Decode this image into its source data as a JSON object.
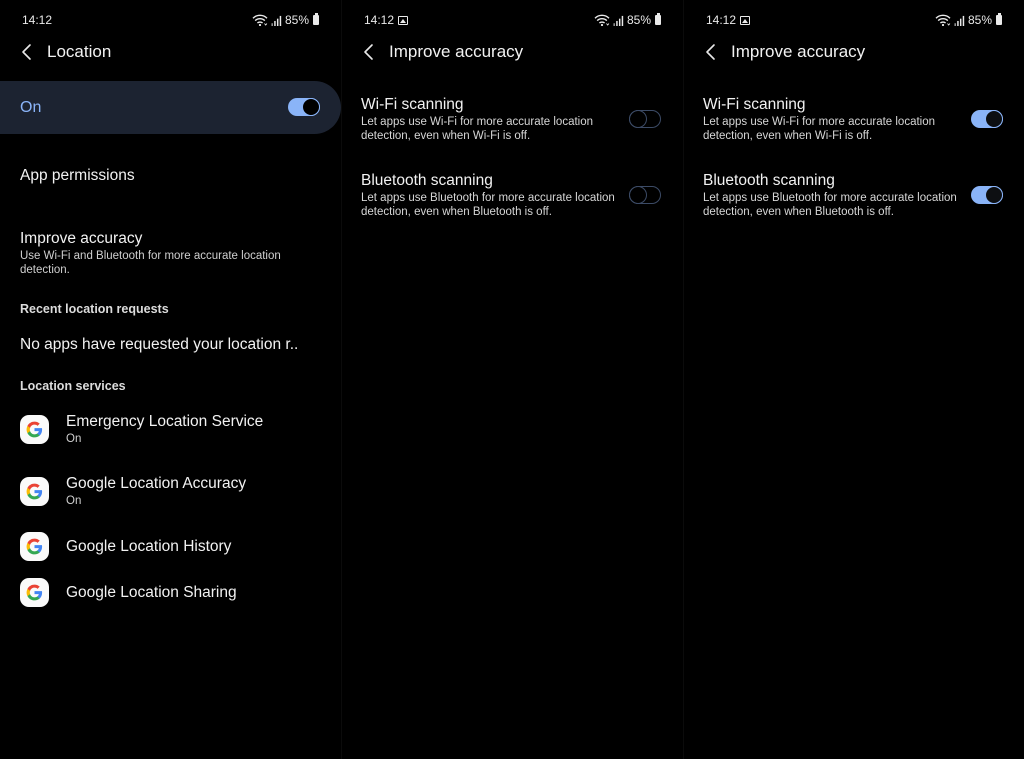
{
  "colors": {
    "accent": "#8ab4f8",
    "card_bg": "#1c2331",
    "toggle_off_outline": "#3c4b66",
    "background": "#000000"
  },
  "status_bar": {
    "time": "14:12",
    "battery": "85%",
    "icons": [
      "wifi-icon",
      "signal-icon",
      "battery-icon"
    ]
  },
  "panels": [
    {
      "status_bar": {
        "time": "14:12",
        "battery": "85%",
        "has_image_notification": false
      },
      "header": {
        "back_icon": "chevron-left-icon",
        "title": "Location"
      },
      "master_toggle": {
        "label": "On",
        "checked": true
      },
      "items": [
        {
          "title": "App permissions"
        },
        {
          "title": "Improve accuracy",
          "subtitle": "Use Wi-Fi and Bluetooth for more accurate location detection."
        }
      ],
      "recent_requests": {
        "section_title": "Recent location requests",
        "text": "No apps have requested your location r.."
      },
      "location_services": {
        "section_title": "Location services",
        "services": [
          {
            "icon": "google-g-icon",
            "title": "Emergency Location Service",
            "status": "On"
          },
          {
            "icon": "google-g-icon",
            "title": "Google Location Accuracy",
            "status": "On"
          },
          {
            "icon": "google-g-icon",
            "title": "Google Location History",
            "status": ""
          },
          {
            "icon": "google-g-icon",
            "title": "Google Location Sharing",
            "status": ""
          }
        ]
      }
    },
    {
      "status_bar": {
        "time": "14:12",
        "battery": "85%",
        "has_image_notification": true
      },
      "header": {
        "back_icon": "chevron-left-icon",
        "title": "Improve accuracy"
      },
      "settings": [
        {
          "title": "Wi-Fi scanning",
          "subtitle": "Let apps use Wi-Fi for more accurate location detection, even when Wi-Fi is off.",
          "checked": false
        },
        {
          "title": "Bluetooth scanning",
          "subtitle": "Let apps use Bluetooth for more accurate location detection, even when Bluetooth is off.",
          "checked": false
        }
      ]
    },
    {
      "status_bar": {
        "time": "14:12",
        "battery": "85%",
        "has_image_notification": true
      },
      "header": {
        "back_icon": "chevron-left-icon",
        "title": "Improve accuracy"
      },
      "settings": [
        {
          "title": "Wi-Fi scanning",
          "subtitle": "Let apps use Wi-Fi for more accurate location detection, even when Wi-Fi is off.",
          "checked": true
        },
        {
          "title": "Bluetooth scanning",
          "subtitle": "Let apps use Bluetooth for more accurate location detection, even when Bluetooth is off.",
          "checked": true
        }
      ]
    }
  ]
}
